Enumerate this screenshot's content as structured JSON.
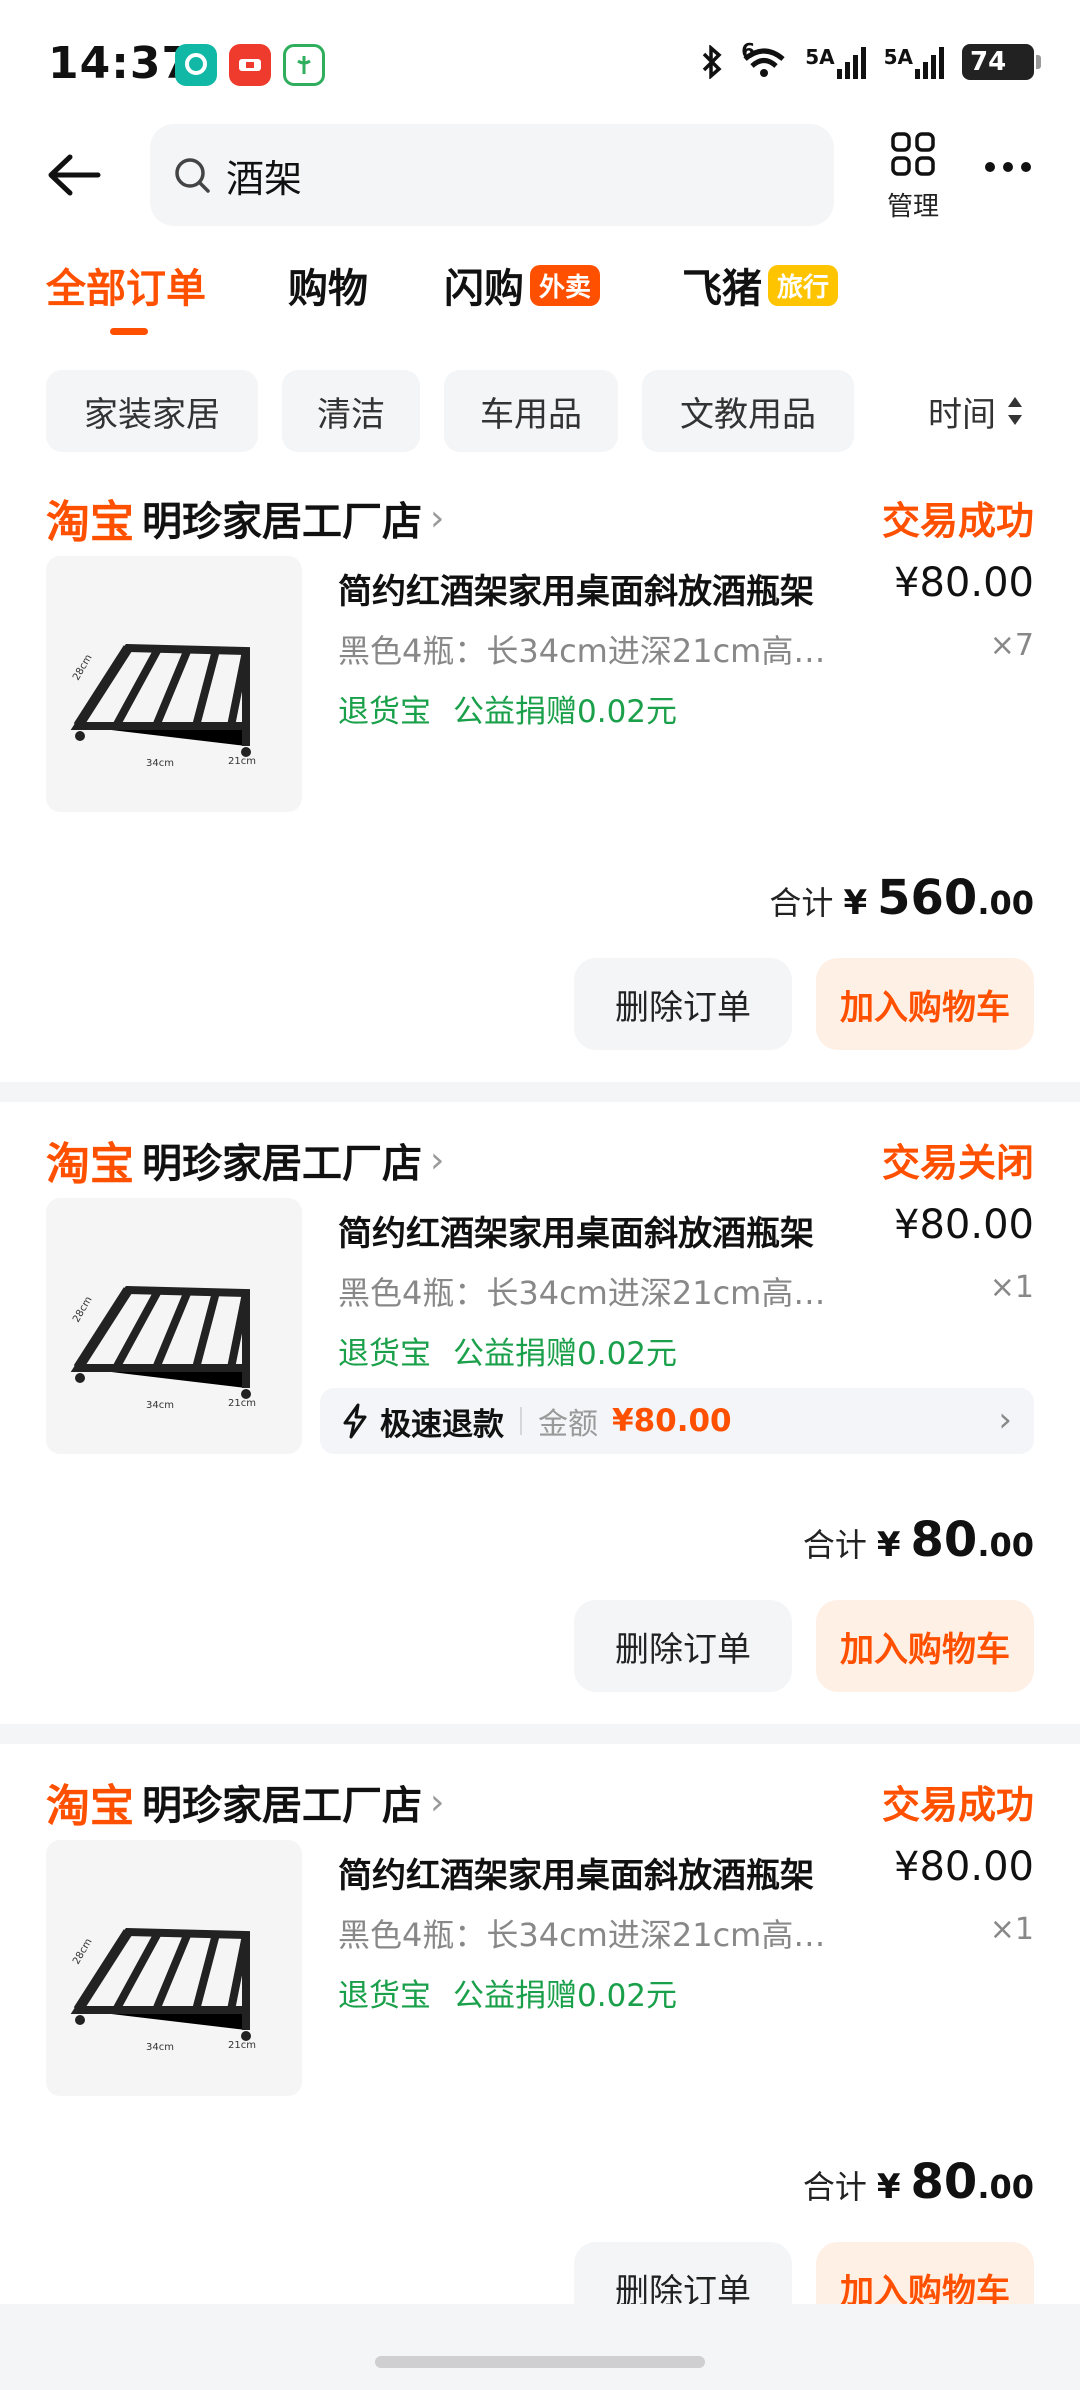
{
  "status_bar": {
    "time": "14:37",
    "network_label_1": "6",
    "network_label_2": "5A",
    "network_label_3": "5A",
    "battery": "74"
  },
  "search": {
    "query": "酒架",
    "manage_label": "管理"
  },
  "tabs": [
    {
      "label": "全部订单"
    },
    {
      "label": "购物"
    },
    {
      "label": "闪购",
      "badge": "外卖",
      "badge_color": "#ff5000"
    },
    {
      "label": "飞猪",
      "badge": "旅行",
      "badge_color": "#ffc400"
    }
  ],
  "filters": [
    "家装家居",
    "清洁",
    "车用品",
    "文教用品"
  ],
  "sort_label": "时间",
  "orders": [
    {
      "brand": "淘宝",
      "shop": "明珍家居工厂店",
      "status": "交易成功",
      "title": "简约红酒架家用桌面斜放酒瓶架",
      "price": "¥80.00",
      "sku": "黑色4瓶：长34cm进深21cm高…",
      "qty": "×7",
      "tag1": "退货宝",
      "tag2": "公益捐赠0.02元",
      "total_label": "合计",
      "total_currency": "¥",
      "total_int": "560",
      "total_dec": ".00",
      "btn_delete": "删除订单",
      "btn_cart": "加入购物车"
    },
    {
      "brand": "淘宝",
      "shop": "明珍家居工厂店",
      "status": "交易关闭",
      "title": "简约红酒架家用桌面斜放酒瓶架",
      "price": "¥80.00",
      "sku": "黑色4瓶：长34cm进深21cm高…",
      "qty": "×1",
      "tag1": "退货宝",
      "tag2": "公益捐赠0.02元",
      "refund_title": "极速退款",
      "refund_amount_label": "金额",
      "refund_amount": "¥80.00",
      "total_label": "合计",
      "total_currency": "¥",
      "total_int": "80",
      "total_dec": ".00",
      "btn_delete": "删除订单",
      "btn_cart": "加入购物车"
    },
    {
      "brand": "淘宝",
      "shop": "明珍家居工厂店",
      "status": "交易成功",
      "title": "简约红酒架家用桌面斜放酒瓶架",
      "price": "¥80.00",
      "sku": "黑色4瓶：长34cm进深21cm高…",
      "qty": "×1",
      "tag1": "退货宝",
      "tag2": "公益捐赠0.02元",
      "total_label": "合计",
      "total_currency": "¥",
      "total_int": "80",
      "total_dec": ".00",
      "btn_delete": "删除订单",
      "btn_cart": "加入购物车"
    }
  ],
  "colors": {
    "accent": "#ff5000",
    "green": "#1aa04a",
    "chip_bg": "#f4f5f7"
  },
  "image_labels": {
    "depth": "21cm",
    "width": "34cm",
    "height": "28cm"
  }
}
